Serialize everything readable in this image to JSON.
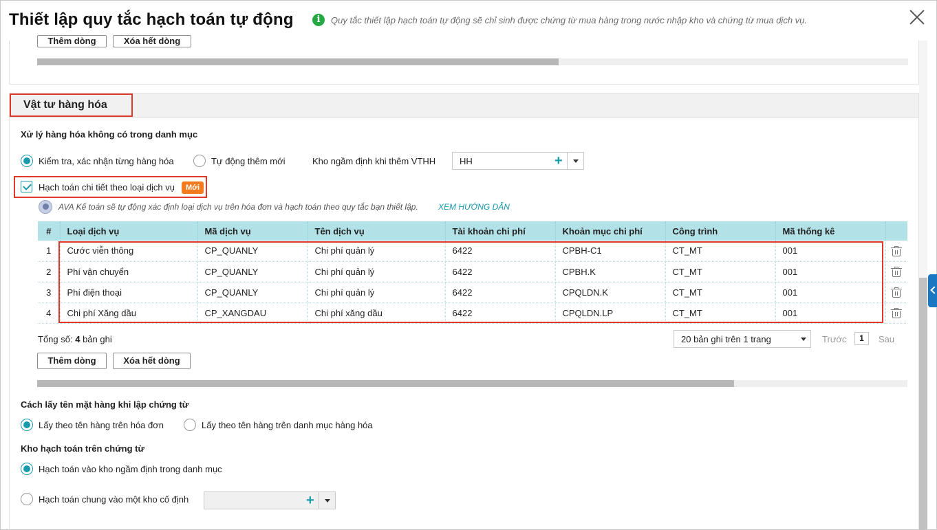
{
  "dialog": {
    "title": "Thiết lập quy tắc hạch toán tự động",
    "info": "Quy tắc thiết lập hạch toán tự động sẽ chỉ sinh được chứng từ mua hàng trong nước nhập kho và chứng từ mua dịch vụ."
  },
  "top_panel": {
    "add_row": "Thêm dòng",
    "clear_rows": "Xóa hết dòng"
  },
  "section": {
    "title": "Vật tư hàng hóa",
    "not_in_catalog": {
      "label": "Xử lý hàng hóa không có trong danh mục",
      "option_check": "Kiểm tra, xác nhận từng hàng hóa",
      "option_auto": "Tự động thêm mới",
      "warehouse_label": "Kho ngầm định khi thêm VTHH",
      "warehouse_value": "HH"
    },
    "detail_by_service": {
      "label": "Hạch toán chi tiết theo loại dịch vụ",
      "badge": "Mới",
      "ava_text": "AVA Kế toán sẽ tự động xác định loại dịch vụ trên hóa đơn và hạch toán theo quy tắc bạn thiết lập.",
      "guide_link": "XEM HƯỚNG DẪN"
    },
    "table": {
      "columns": [
        "#",
        "Loại dịch vụ",
        "Mã dịch vụ",
        "Tên dịch vụ",
        "Tài khoản chi phí",
        "Khoản mục chi phí",
        "Công trình",
        "Mã thống kê"
      ],
      "rows": [
        [
          "1",
          "Cước viễn thông",
          "CP_QUANLY",
          "Chi phí quản lý",
          "6422",
          "CPBH-C1",
          "CT_MT",
          "001"
        ],
        [
          "2",
          "Phí vận chuyển",
          "CP_QUANLY",
          "Chi phí quản lý",
          "6422",
          "CPBH.K",
          "CT_MT",
          "001"
        ],
        [
          "3",
          "Phí điện thoại",
          "CP_QUANLY",
          "Chi phí quản lý",
          "6422",
          "CPQLDN.K",
          "CT_MT",
          "001"
        ],
        [
          "4",
          "Chi phí Xăng dầu",
          "CP_XANGDAU",
          "Chi phí xăng dầu",
          "6422",
          "CPQLDN.LP",
          "CT_MT",
          "001"
        ]
      ]
    },
    "pager": {
      "total_prefix": "Tổng số:",
      "total_count": "4",
      "total_suffix": "bản ghi",
      "page_size": "20 bản ghi trên 1 trang",
      "prev": "Trước",
      "page": "1",
      "next": "Sau"
    },
    "add_row": "Thêm dòng",
    "clear_rows": "Xóa hết dòng",
    "naming": {
      "label": "Cách lấy tên mặt hàng khi lập chứng từ",
      "option_invoice": "Lấy theo tên hàng trên hóa đơn",
      "option_catalog": "Lấy theo tên hàng trên danh mục hàng hóa"
    },
    "warehouse": {
      "label": "Kho hạch toán trên chứng từ",
      "option_default": "Hạch toán vào kho ngầm định trong danh mục",
      "option_fixed": "Hạch toán chung vào một kho cố định"
    }
  },
  "colors": {
    "accent": "#1a9bac",
    "highlight": "#e0382b",
    "table_header": "#b2e1e7",
    "badge": "#f37b1d",
    "info": "#27a844"
  }
}
